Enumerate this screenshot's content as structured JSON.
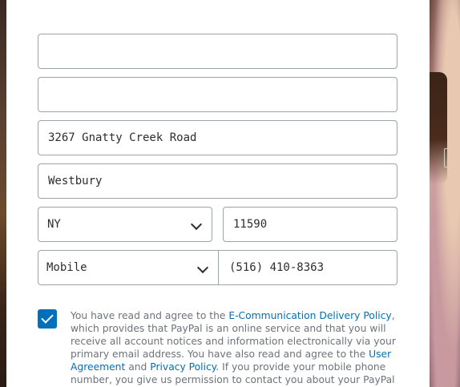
{
  "form": {
    "first_name": {
      "value": ""
    },
    "last_name": {
      "value": ""
    },
    "street": {
      "value": "3267 Gnatty Creek Road"
    },
    "city": {
      "value": "Westbury"
    },
    "state": {
      "value": "NY"
    },
    "zip": {
      "value": "11590"
    },
    "phone_type": {
      "value": "Mobile"
    },
    "phone_number": {
      "value": "(516) 410-8363"
    }
  },
  "consent": {
    "checked": true,
    "text_1": "You have read and agree to the ",
    "link_ecomm": "E-Communication Delivery Policy",
    "text_2": ", which provides that PayPal is an online service and that you will receive all account notices and information electronically via your primary email address. You have also read and agree to the ",
    "link_user_agreement": "User Agreement",
    "text_3": " and ",
    "link_privacy": "Privacy Policy",
    "text_4": ". If you provide your mobile phone number, you give us permission to contact you about your PayPal"
  },
  "colors": {
    "accent": "#0070ba",
    "text": "#2c2e2f",
    "muted_text": "#6c7378",
    "border": "#9da3a6"
  },
  "icons": {
    "dropdown": "chevron-down-icon",
    "checkbox": "checkmark-icon"
  }
}
